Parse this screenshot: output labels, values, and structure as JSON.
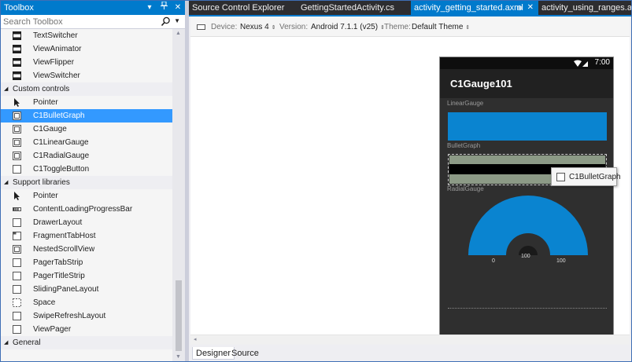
{
  "toolbox": {
    "title": "Toolbox",
    "search_placeholder": "Search Toolbox",
    "rows": [
      {
        "kind": "item",
        "label": "TextSwitcher",
        "icon": "view-switcher-icon"
      },
      {
        "kind": "item",
        "label": "ViewAnimator",
        "icon": "view-switcher-icon"
      },
      {
        "kind": "item",
        "label": "ViewFlipper",
        "icon": "view-switcher-icon"
      },
      {
        "kind": "item",
        "label": "ViewSwitcher",
        "icon": "view-switcher-icon"
      },
      {
        "kind": "category",
        "label": "Custom controls"
      },
      {
        "kind": "item",
        "label": "Pointer",
        "icon": "pointer-icon"
      },
      {
        "kind": "item",
        "label": "C1BulletGraph",
        "icon": "control-box-icon",
        "selected": true
      },
      {
        "kind": "item",
        "label": "C1Gauge",
        "icon": "control-box-icon"
      },
      {
        "kind": "item",
        "label": "C1LinearGauge",
        "icon": "control-box-icon"
      },
      {
        "kind": "item",
        "label": "C1RadialGauge",
        "icon": "control-box-icon"
      },
      {
        "kind": "item",
        "label": "C1ToggleButton",
        "icon": "empty-box-icon"
      },
      {
        "kind": "category",
        "label": "Support libraries"
      },
      {
        "kind": "item",
        "label": "Pointer",
        "icon": "pointer-icon"
      },
      {
        "kind": "item",
        "label": "ContentLoadingProgressBar",
        "icon": "progress-bar-icon"
      },
      {
        "kind": "item",
        "label": "DrawerLayout",
        "icon": "empty-box-icon"
      },
      {
        "kind": "item",
        "label": "FragmentTabHost",
        "icon": "tab-host-icon"
      },
      {
        "kind": "item",
        "label": "NestedScrollView",
        "icon": "control-box-icon"
      },
      {
        "kind": "item",
        "label": "PagerTabStrip",
        "icon": "empty-box-icon"
      },
      {
        "kind": "item",
        "label": "PagerTitleStrip",
        "icon": "empty-box-icon"
      },
      {
        "kind": "item",
        "label": "SlidingPaneLayout",
        "icon": "empty-box-icon"
      },
      {
        "kind": "item",
        "label": "Space",
        "icon": "dashed-box-icon"
      },
      {
        "kind": "item",
        "label": "SwipeRefreshLayout",
        "icon": "empty-box-icon"
      },
      {
        "kind": "item",
        "label": "ViewPager",
        "icon": "empty-box-icon"
      },
      {
        "kind": "category",
        "label": "General"
      }
    ]
  },
  "tabs": [
    {
      "label": "Source Control Explorer",
      "active": false
    },
    {
      "label": "GettingStartedActivity.cs",
      "active": false
    },
    {
      "label": "activity_getting_started.axml",
      "active": true
    },
    {
      "label": "activity_using_ranges.axml",
      "active": false
    }
  ],
  "designer_toolbar": {
    "device_label": "Device:",
    "device_value": "Nexus 4",
    "version_label": "Version:",
    "version_value": "Android 7.1.1 (v25)",
    "theme_label": "Theme:",
    "theme_value": "Default Theme"
  },
  "phone": {
    "clock": "7:00",
    "app_title": "C1Gauge101",
    "linear_label": "LinearGauge",
    "bullet_label": "BulletGraph",
    "radial_label": "RadialGauge",
    "radial_min": "0",
    "radial_value": "100",
    "radial_max": "100"
  },
  "tooltip": {
    "label": "C1BulletGraph"
  },
  "bottom_tabs": [
    {
      "label": "Designer",
      "active": true
    },
    {
      "label": "Source",
      "active": false
    }
  ],
  "colors": {
    "accent": "#007acc",
    "selection": "#3399ff",
    "gauge_blue": "#0a84d0"
  }
}
